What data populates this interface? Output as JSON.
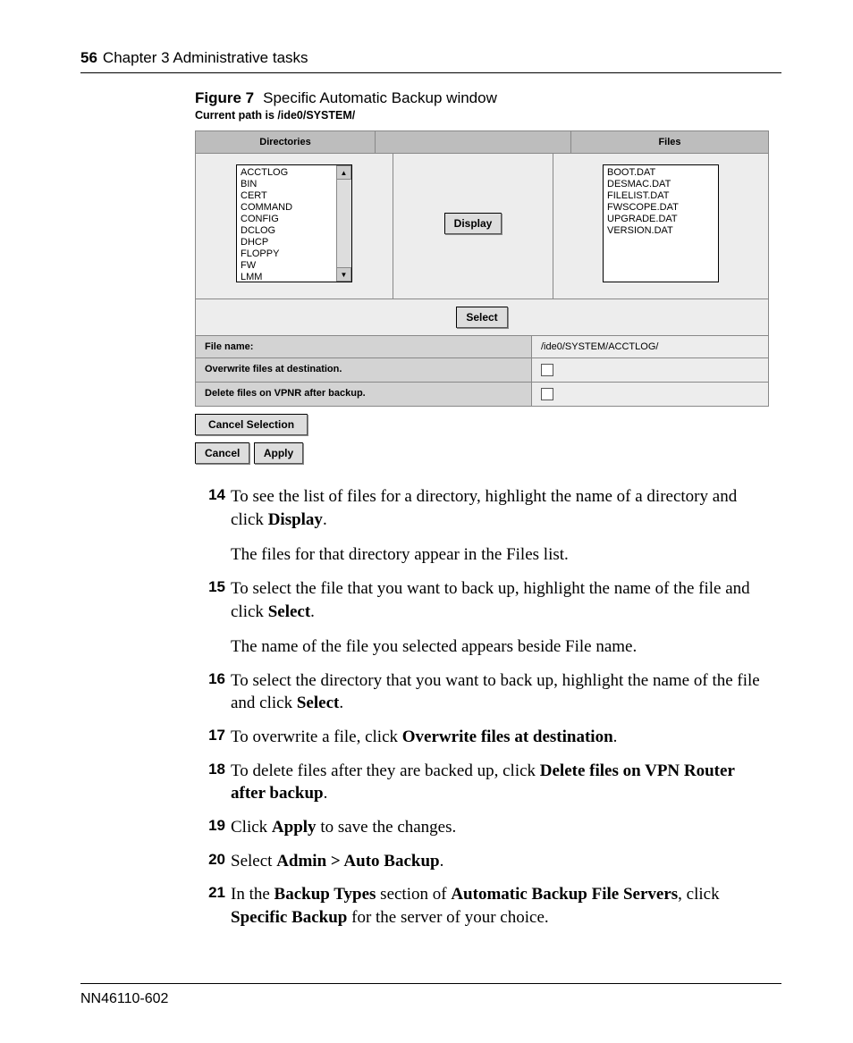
{
  "header": {
    "page_number": "56",
    "chapter_text": "Chapter 3  Administrative tasks"
  },
  "figure": {
    "label": "Figure 7",
    "title": "Specific Automatic Backup window",
    "path_line": "Current path is /ide0/SYSTEM/"
  },
  "panel": {
    "dir_header": "Directories",
    "files_header": "Files",
    "directories": [
      "ACCTLOG",
      "BIN",
      "CERT",
      "COMMAND",
      "CONFIG",
      "DCLOG",
      "DHCP",
      "FLOPPY",
      "FW",
      "LMM"
    ],
    "files": [
      "BOOT.DAT",
      "DESMAC.DAT",
      "FILELIST.DAT",
      "FWSCOPE.DAT",
      "UPGRADE.DAT",
      "VERSION.DAT"
    ],
    "display_btn": "Display",
    "select_btn": "Select",
    "filename_label": "File name:",
    "filename_value": "/ide0/SYSTEM/ACCTLOG/",
    "overwrite_label": "Overwrite files at destination.",
    "delete_label": "Delete files on VPNR after backup.",
    "cancel_selection_btn": "Cancel Selection",
    "cancel_btn": "Cancel",
    "apply_btn": "Apply"
  },
  "steps": {
    "s14": {
      "num": "14",
      "p1a": "To see the list of files for a directory, highlight the name of a directory and click ",
      "p1b": "Display",
      "p1c": ".",
      "p2": "The files for that directory appear in the Files list."
    },
    "s15": {
      "num": "15",
      "p1a": "To select the file that you want to back up, highlight the name of the file and click ",
      "p1b": "Select",
      "p1c": ".",
      "p2": "The name of the file you selected appears beside File name."
    },
    "s16": {
      "num": "16",
      "p1a": "To select the directory that you want to back up, highlight the name of the file and click ",
      "p1b": "Select",
      "p1c": "."
    },
    "s17": {
      "num": "17",
      "p1a": "To overwrite a file, click ",
      "p1b": "Overwrite files at destination",
      "p1c": "."
    },
    "s18": {
      "num": "18",
      "p1a": "To delete files after they are backed up, click ",
      "p1b": "Delete files on VPN Router after backup",
      "p1c": "."
    },
    "s19": {
      "num": "19",
      "p1a": "Click ",
      "p1b": "Apply",
      "p1c": " to save the changes."
    },
    "s20": {
      "num": "20",
      "p1a": "Select ",
      "p1b": "Admin > Auto Backup",
      "p1c": "."
    },
    "s21": {
      "num": "21",
      "p1a": "In the ",
      "p1b": "Backup Types",
      "p1c": " section of ",
      "p1d": "Automatic Backup File Servers",
      "p1e": ", click ",
      "p1f": "Specific Backup",
      "p1g": " for the server of your choice."
    }
  },
  "footer": {
    "doc_id": "NN46110-602"
  }
}
